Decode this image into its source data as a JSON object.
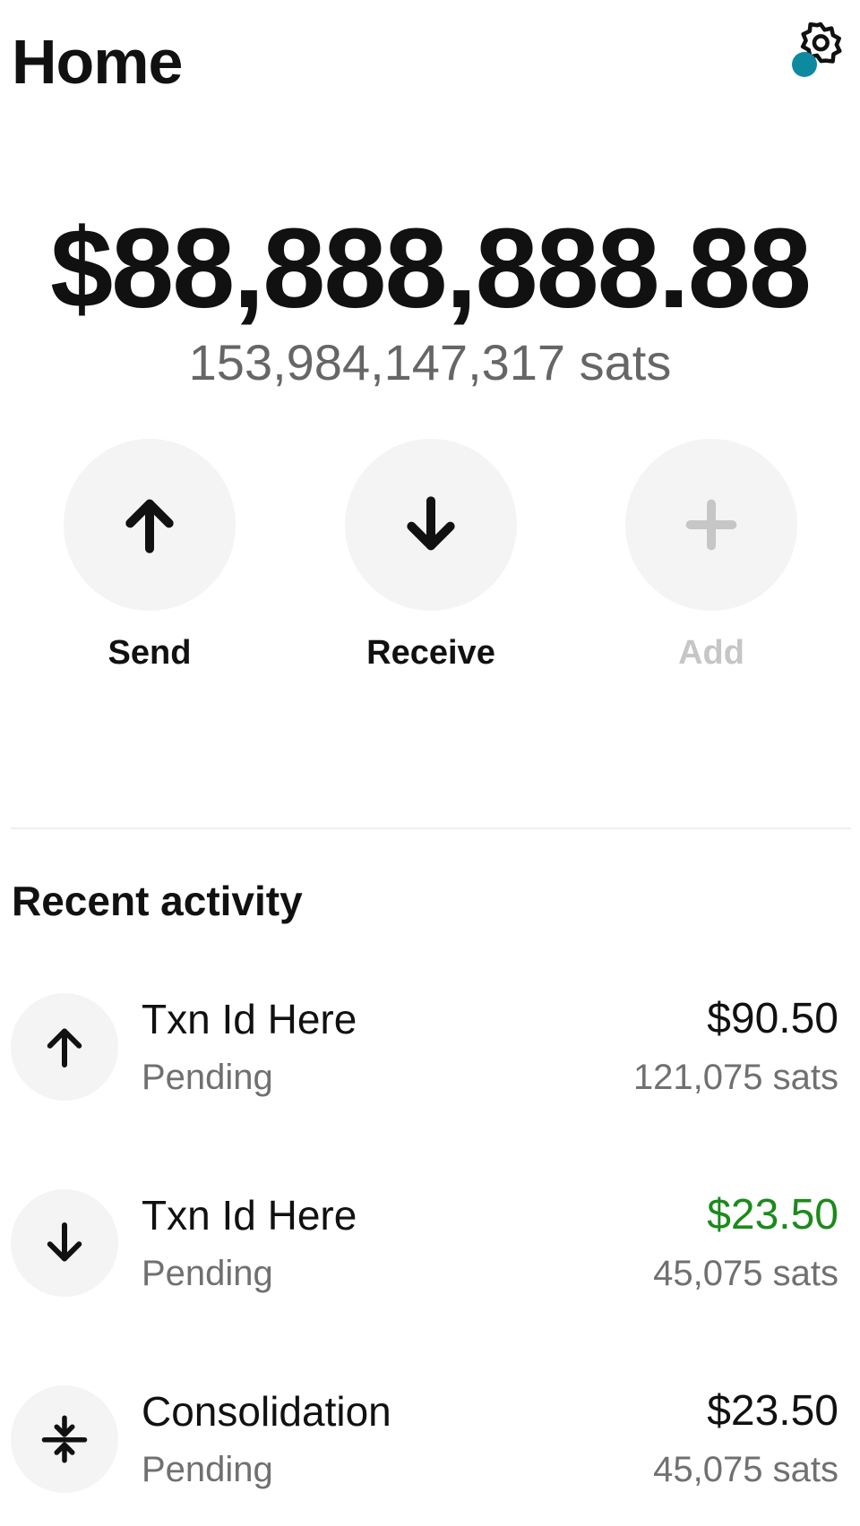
{
  "header": {
    "title": "Home",
    "settings_icon": "gear-icon",
    "status_dot_color": "#0e8aa0"
  },
  "balance": {
    "fiat": "$88,888,888.88",
    "sats": "153,984,147,317 sats"
  },
  "actions": [
    {
      "label": "Send",
      "icon": "arrow-up-icon",
      "enabled": true
    },
    {
      "label": "Receive",
      "icon": "arrow-down-icon",
      "enabled": true
    },
    {
      "label": "Add",
      "icon": "plus-icon",
      "enabled": false
    }
  ],
  "activity": {
    "title": "Recent activity",
    "items": [
      {
        "icon": "arrow-up-icon",
        "name": "Txn Id Here",
        "status": "Pending",
        "amount": "$90.50",
        "sats": "121,075 sats",
        "amount_color": "#111111"
      },
      {
        "icon": "arrow-down-icon",
        "name": "Txn Id Here",
        "status": "Pending",
        "amount": "$23.50",
        "sats": "45,075 sats",
        "amount_color": "#1c8a1c"
      },
      {
        "icon": "consolidate-icon",
        "name": "Consolidation",
        "status": "Pending",
        "amount": "$23.50",
        "sats": "45,075 sats",
        "amount_color": "#111111"
      }
    ]
  }
}
